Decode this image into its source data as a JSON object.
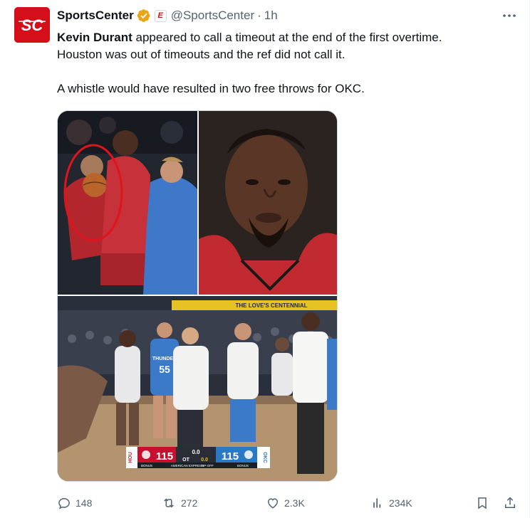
{
  "author": {
    "display_name": "SportsCenter",
    "handle": "@SportsCenter",
    "separator": "·",
    "time": "1h",
    "avatar_text": "SC",
    "affiliate_badge": "E",
    "brand_color": "#d40f1a",
    "verified_color": "#e8a517"
  },
  "tweet": {
    "bold_name": "Kevin Durant",
    "line1_rest": " appeared to call a timeout at the end of the first overtime.",
    "line2": "Houston was out of timeouts and the ref did not call it.",
    "line3": "A whistle would have resulted in two free throws for OKC."
  },
  "media": {
    "scoreboard": {
      "home_abbr": "HOU",
      "home_score": "115",
      "period": "OT",
      "clock": "0.0",
      "shot_clock": "0.0",
      "away_score": "115",
      "away_abbr": "OKC",
      "home_label": "BONUS",
      "away_label": "BONUS",
      "sponsor": "AMERICAN EXPRESS",
      "sponsor_tag": "TIP-OFF"
    },
    "jersey_number": "55",
    "jersey_team": "THUNDER",
    "banner_text": "THE LOVE'S CENTENNIAL"
  },
  "actions": {
    "replies": "148",
    "retweets": "272",
    "likes": "2.3K",
    "views": "234K"
  },
  "icons": {
    "more": "more-icon",
    "reply": "reply-icon",
    "retweet": "retweet-icon",
    "like": "heart-icon",
    "views": "views-icon",
    "bookmark": "bookmark-icon",
    "share": "share-icon"
  }
}
